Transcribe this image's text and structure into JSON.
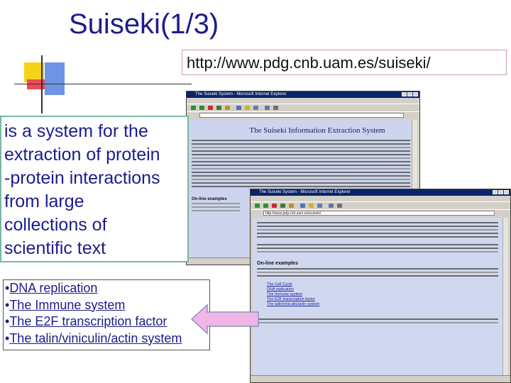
{
  "slide": {
    "title": "Suiseki(1/3)",
    "url": "http://www.pdg.cnb.uam.es/suiseki/",
    "description_lines": [
      "is a system for the",
      "extraction of protein",
      "-protein interactions",
      "from large",
      "collections of",
      "scientific text"
    ],
    "bullet": "•",
    "links": [
      "DNA replication",
      "The Immune system",
      "The E2F transcription factor",
      "The talin/viniculin/actin system"
    ]
  },
  "browser_back": {
    "title_text": "The Suiseki System - Microsoft Internet Explorer",
    "page_heading": "The Suiseki Information Extraction System",
    "section": "On-line examples"
  },
  "browser_front": {
    "title_text": "The Suiseki System - Microsoft Internet Explorer",
    "address": "http://www.pdg.cnb.uam.es/suiseki/",
    "section": "On-line examples",
    "examples": [
      "The Cell Cycle",
      "DNA replication",
      "The Immune system",
      "The E2F transcription factor",
      "The talin/viniculin/actin system"
    ]
  },
  "colors": {
    "title_blue": "#1c1c8c",
    "arrow_fill": "#f0b6e6",
    "arrow_stroke": "#9090c0",
    "page_bg": "#d0d8f0",
    "desc_border": "#7ab7a5",
    "url_border": "#d69ab4"
  }
}
